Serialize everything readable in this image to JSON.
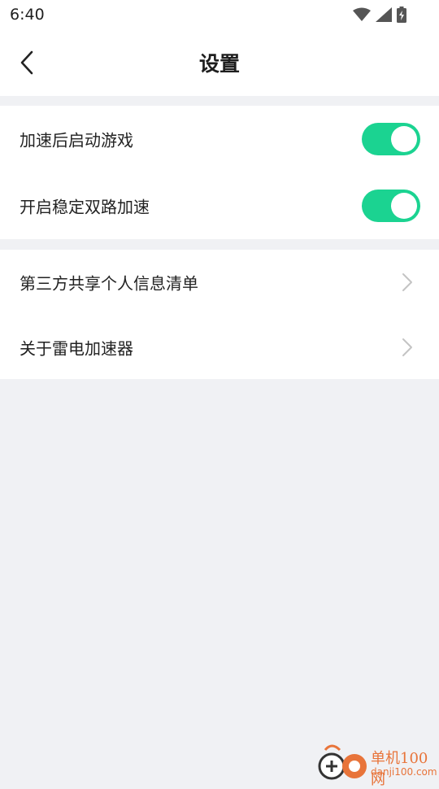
{
  "status_bar": {
    "time": "6:40"
  },
  "header": {
    "title": "设置"
  },
  "settings": {
    "toggles": [
      {
        "label": "加速后启动游戏",
        "enabled": true
      },
      {
        "label": "开启稳定双路加速",
        "enabled": true
      }
    ],
    "links": [
      {
        "label": "第三方共享个人信息清单"
      },
      {
        "label": "关于雷电加速器"
      }
    ]
  },
  "watermark": {
    "name": "单机100网",
    "domain": "danji100.com"
  },
  "colors": {
    "toggle_on": "#1bd391",
    "background": "#f0f1f4",
    "watermark": "#e8743a"
  }
}
